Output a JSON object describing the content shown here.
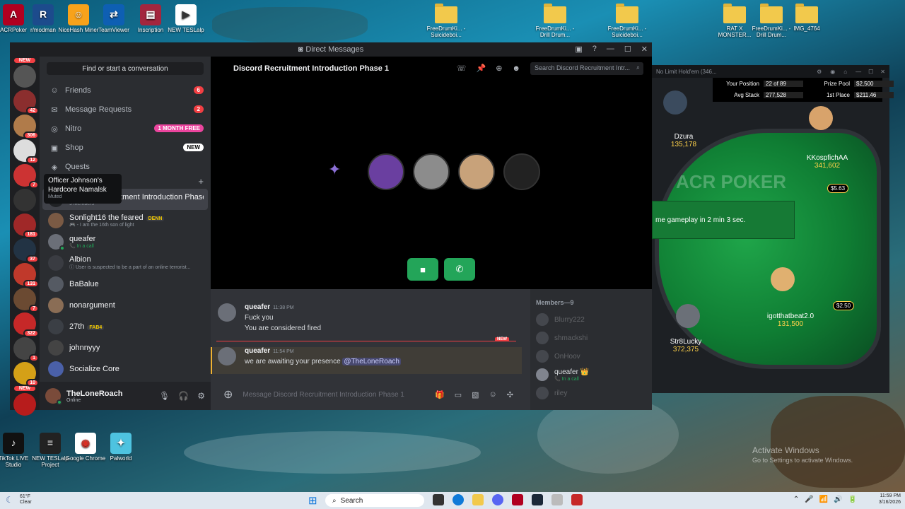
{
  "desktop": {
    "icons_top": [
      {
        "label": "ACRPoker",
        "color": "#b00020",
        "glyph": "A"
      },
      {
        "label": "r/modman",
        "color": "#1c4b8c",
        "glyph": "R"
      },
      {
        "label": "NiceHash Miner",
        "color": "#f7a21b",
        "glyph": "☺"
      },
      {
        "label": "TeamViewer",
        "color": "#0e5fb3",
        "glyph": "⇄"
      },
      {
        "label": "Inscription",
        "color": "#a3263e",
        "glyph": "▤"
      },
      {
        "label": "NEW TESLalp",
        "color": "#ffffff",
        "glyph": "▶"
      }
    ],
    "folders_top": [
      {
        "label": "FreeDrumKi... - Suicideboi..."
      },
      {
        "label": "FreeDrumKi... - Drill Drum..."
      },
      {
        "label": "FreeDrumKi... - Suicideboi..."
      },
      {
        "label": "RAT X MONSTER..."
      },
      {
        "label": "FreeDrumKi... - Drill Drum..."
      },
      {
        "label": "IMG_4764"
      }
    ],
    "icons_bottom": [
      {
        "label": "TikTok LIVE Studio",
        "color": "#111111",
        "glyph": "♪"
      },
      {
        "label": "NEW TESLalp Project",
        "color": "#222222",
        "glyph": "≡"
      },
      {
        "label": "Google Chrome",
        "color": "#ffffff",
        "glyph": "◉"
      },
      {
        "label": "Palworld",
        "color": "#4ec3e0",
        "glyph": "✦"
      }
    ],
    "activate_windows": {
      "title": "Activate Windows",
      "sub": "Go to Settings to activate Windows."
    }
  },
  "rail": {
    "items": [
      {
        "badge": "",
        "new": true,
        "color": "#555"
      },
      {
        "badge": "42",
        "color": "#8b2e2e"
      },
      {
        "badge": "306",
        "color": "#b07b4a"
      },
      {
        "badge": "12",
        "color": "#ddd"
      },
      {
        "badge": "7",
        "color": "#c33"
      },
      {
        "badge": "",
        "color": "#333"
      },
      {
        "badge": "181",
        "color": "#a02828"
      },
      {
        "badge": "37",
        "color": "#234"
      },
      {
        "badge": "131",
        "color": "#c0392b"
      },
      {
        "badge": "7",
        "color": "#6b4a32"
      },
      {
        "badge": "322",
        "color": "#c62828"
      },
      {
        "badge": "1",
        "color": "#444"
      },
      {
        "badge": "10",
        "color": "#d4a017"
      },
      {
        "badge": "",
        "new": true,
        "color": "#b71c1c"
      }
    ]
  },
  "discord": {
    "window_title": "Direct Messages",
    "search_placeholder": "Find or start a conversation",
    "nav": [
      {
        "icon": "friends-icon",
        "glyph": "☺",
        "label": "Friends",
        "badge": "6",
        "badge_kind": "red"
      },
      {
        "icon": "mail-icon",
        "glyph": "✉",
        "label": "Message Requests",
        "badge": "2",
        "badge_kind": "red"
      },
      {
        "icon": "nitro-icon",
        "glyph": "◎",
        "label": "Nitro",
        "badge": "1 MONTH FREE",
        "badge_kind": "pink"
      },
      {
        "icon": "shop-icon",
        "glyph": "▣",
        "label": "Shop",
        "badge": "NEW",
        "badge_kind": "white"
      },
      {
        "icon": "quests-icon",
        "glyph": "◈",
        "label": "Quests",
        "badge": "",
        "badge_kind": ""
      }
    ],
    "tooltip": {
      "title": "Officer Johnson's Hardcore Namalsk",
      "sub": "Muted"
    },
    "dms": [
      {
        "name": "Discord Recruitment Introduction Phase 1",
        "sub": "9 Members",
        "selected": true,
        "color": "#202225",
        "tag": "",
        "sub_green": false
      },
      {
        "name": "Sonlight16 the feared",
        "sub": "🎮 - I am the 16th son of light",
        "selected": false,
        "color": "#7a5a44",
        "tag": "DENN",
        "sub_green": false
      },
      {
        "name": "queafer",
        "sub": "📞 In a call",
        "selected": false,
        "color": "#6b6f78",
        "tag": "",
        "sub_green": true
      },
      {
        "name": "Albion",
        "sub": "ⓘ User is suspected to be a part of an online terrorist...",
        "selected": false,
        "color": "#3a3c42",
        "tag": "",
        "sub_green": false
      },
      {
        "name": "BaBalue",
        "sub": "",
        "selected": false,
        "color": "#555a63",
        "tag": "",
        "sub_green": false
      },
      {
        "name": "nonargument",
        "sub": "",
        "selected": false,
        "color": "#8a6d55",
        "tag": "",
        "sub_green": false
      },
      {
        "name": "27th",
        "sub": "",
        "selected": false,
        "color": "#3b3f45",
        "tag": "FAB4",
        "sub_green": false
      },
      {
        "name": "johnnyyy",
        "sub": "",
        "selected": false,
        "color": "#444",
        "tag": "",
        "sub_green": false
      },
      {
        "name": "Socialize Core",
        "sub": "",
        "selected": false,
        "color": "#4a60a8",
        "tag": "",
        "sub_green": false
      }
    ],
    "user": {
      "name": "TheLoneRoach",
      "status": "Online"
    },
    "channel": {
      "title": "Discord Recruitment Introduction Phase 1",
      "search_placeholder": "Search Discord Recruitment Intr..."
    },
    "call_avatars": [
      {
        "color": "#6a3fa0"
      },
      {
        "color": "#8c8c8c"
      },
      {
        "color": "#c8a27a"
      },
      {
        "color": "#222"
      }
    ],
    "messages": [
      {
        "author": "queafer",
        "time": "11:38 PM",
        "lines": [
          "Fuck you",
          "You are considered fired"
        ]
      },
      {
        "author": "queafer",
        "time": "11:54 PM",
        "text": "we are awaiting your presence",
        "mention": "@TheLoneRoach"
      }
    ],
    "new_label": "NEW",
    "composer_placeholder": "Message Discord Recruitment Introduction Phase 1",
    "members_header": "Members—9",
    "members": [
      {
        "name": "Blurry222",
        "sub": "",
        "online": false
      },
      {
        "name": "shmackshi",
        "sub": "",
        "online": false
      },
      {
        "name": "OnHoov",
        "sub": "",
        "online": false
      },
      {
        "name": "queafer 👑",
        "sub": "📞 In a call",
        "online": true
      },
      {
        "name": "riley",
        "sub": "",
        "online": false
      }
    ]
  },
  "poker": {
    "title": "No Limit Hold'em (346...",
    "stats": [
      {
        "label": "Your Position",
        "value": "22 of 89"
      },
      {
        "label": "Prize Pool",
        "value": "$2,500"
      },
      {
        "label": "Avg Stack",
        "value": "277,528"
      },
      {
        "label": "1st Place",
        "value": "$211.46"
      }
    ],
    "banner": "me gameplay in 2 min 3 sec.",
    "logo": "ACR POKER",
    "players": [
      {
        "name": "Dzura",
        "stack": "135,178"
      },
      {
        "name": "KKospfichAA",
        "stack": "341,602"
      },
      {
        "name": "igotthatbeat2.0",
        "stack": "131,500"
      },
      {
        "name": "Str8Lucky",
        "stack": "372,375"
      }
    ],
    "bets": [
      "$5.63",
      "$2.50"
    ]
  },
  "taskbar": {
    "weather_temp": "61°F",
    "weather_desc": "Clear",
    "search": "Search",
    "time": "11:59 PM",
    "date": "3/16/2026"
  }
}
